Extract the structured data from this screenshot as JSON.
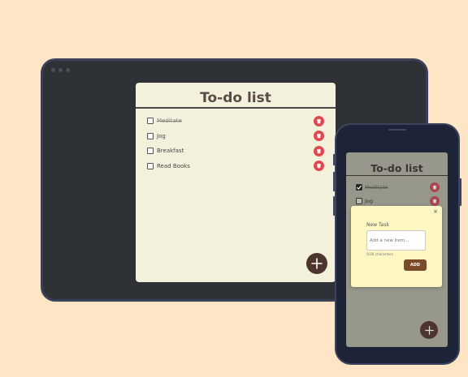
{
  "desktop": {
    "title": "To-do list",
    "tasks": [
      {
        "label": "Meditate",
        "done": true
      },
      {
        "label": "Jog",
        "done": false
      },
      {
        "label": "Breakfast",
        "done": false
      },
      {
        "label": "Read Books",
        "done": false
      }
    ]
  },
  "phone": {
    "title": "To-do list",
    "tasks": [
      {
        "label": "Meditate",
        "done": true
      },
      {
        "label": "Jog",
        "done": false
      }
    ]
  },
  "modal": {
    "label": "New Task",
    "placeholder": "Add a new item...",
    "counter": "0/30 characters",
    "add_label": "ADD",
    "close_glyph": "×"
  },
  "colors": {
    "background": "#fde5c6",
    "card": "#f3f1dc",
    "delete": "#e1474e",
    "fab": "#4d342c",
    "modal": "#fff7c2",
    "add_button": "#7a4a2a"
  },
  "icons": {
    "delete": "trash-icon",
    "fab": "plus-icon"
  }
}
